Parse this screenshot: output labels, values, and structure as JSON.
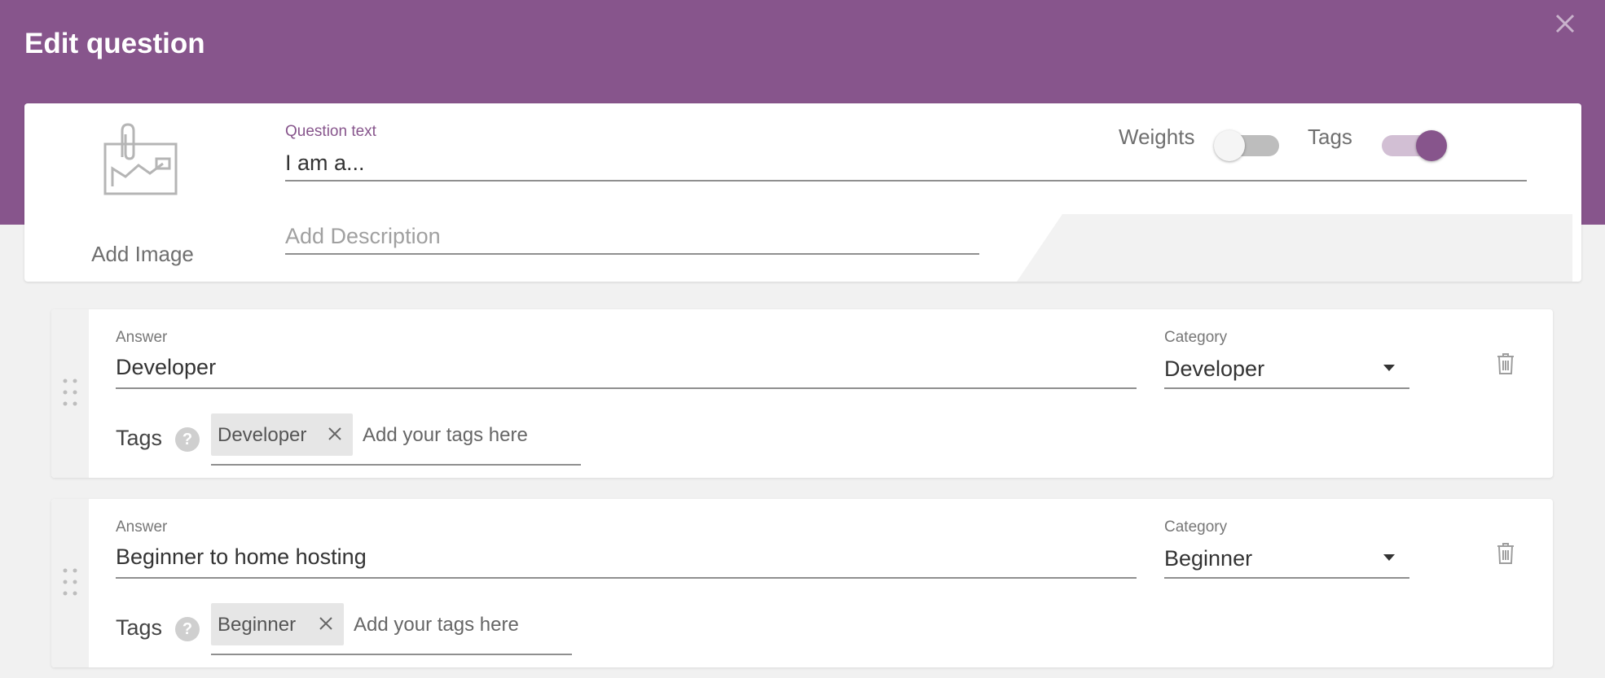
{
  "dialog": {
    "title": "Edit question"
  },
  "question": {
    "add_image_label": "Add Image",
    "text_label": "Question text",
    "text_value": "I am a...",
    "description_placeholder": "Add Description",
    "weights_label": "Weights",
    "weights_enabled": false,
    "tags_label": "Tags",
    "tags_enabled": true
  },
  "answers": [
    {
      "answer_label": "Answer",
      "answer_value": "Developer",
      "category_label": "Category",
      "category_value": "Developer",
      "tags_label": "Tags",
      "tags": [
        "Developer"
      ],
      "tags_placeholder": "Add your tags here"
    },
    {
      "answer_label": "Answer",
      "answer_value": "Beginner to home hosting",
      "category_label": "Category",
      "category_value": "Beginner",
      "tags_label": "Tags",
      "tags": [
        "Beginner"
      ],
      "tags_placeholder": "Add your tags here"
    }
  ],
  "icons": {
    "close": "close-icon",
    "image": "image-attachment-icon",
    "drag": "drag-handle-icon",
    "delete": "trash-icon",
    "help": "help-icon",
    "dropdown": "caret-down-icon",
    "chip_remove": "close-icon"
  },
  "colors": {
    "header": "#87558c",
    "accent": "#87558c",
    "background": "#f1f1f1"
  }
}
